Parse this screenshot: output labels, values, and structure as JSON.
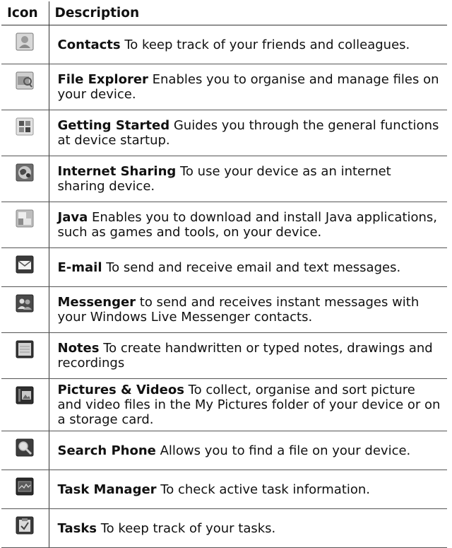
{
  "header": {
    "icon_col": "Icon",
    "desc_col": "Description"
  },
  "rows": [
    {
      "name": "Contacts",
      "text": " To keep track of your friends and colleagues.",
      "icon": "contacts-icon"
    },
    {
      "name": "File Explorer",
      "text": " Enables you to organise and manage files on your device.",
      "icon": "file-explorer-icon"
    },
    {
      "name": "Getting Started",
      "text": " Guides you through the general functions at device startup.",
      "icon": "getting-started-icon"
    },
    {
      "name": "Internet Sharing",
      "text": " To use your device as an internet sharing device.",
      "icon": "internet-sharing-icon"
    },
    {
      "name": "Java",
      "text": " Enables you to download and install Java applications, such as games and tools, on your device.",
      "icon": "java-icon"
    },
    {
      "name": "E-mail",
      "text": " To send and receive email and text messages.",
      "icon": "email-icon"
    },
    {
      "name": "Messenger",
      "text": " to send and receives instant messages with your Windows Live Messenger contacts.",
      "icon": "messenger-icon"
    },
    {
      "name": "Notes",
      "text": " To create handwritten or typed notes, drawings and recordings",
      "icon": "notes-icon"
    },
    {
      "name": "Pictures & Videos",
      "text": " To collect, organise and sort picture and video files in the My Pictures folder of your device or on a storage card.",
      "icon": "pictures-videos-icon"
    },
    {
      "name": "Search Phone",
      "text": " Allows you to find a file on your device.",
      "icon": "search-phone-icon"
    },
    {
      "name": "Task Manager",
      "text": " To check active task information.",
      "icon": "task-manager-icon"
    },
    {
      "name": "Tasks",
      "text": " To keep track of your tasks.",
      "icon": "tasks-icon"
    }
  ]
}
